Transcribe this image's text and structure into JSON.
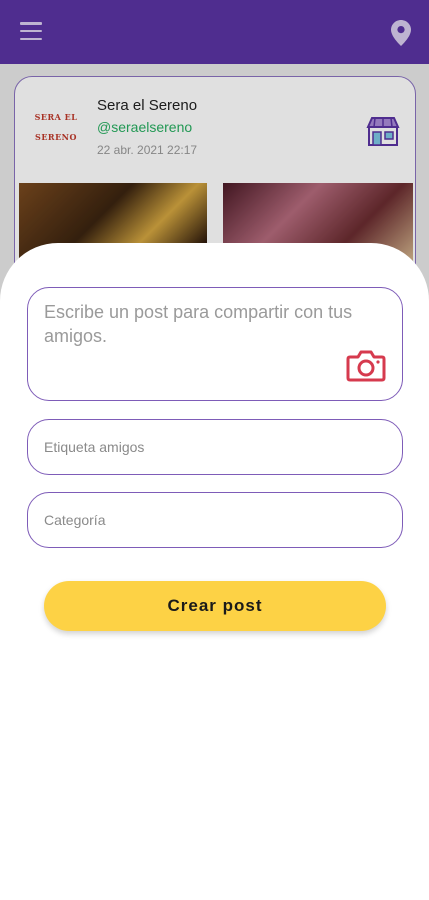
{
  "app_bar": {
    "menu_icon": "menu-icon",
    "location_icon": "location-pin-icon",
    "color": "#5b34a3"
  },
  "feed_post": {
    "logo_text": "SERA EL SERENO",
    "author": "Sera el Sereno",
    "handle": "@seraelsereno",
    "date": "22 abr. 2021 22:17",
    "store_icon": "store-icon"
  },
  "create_post_sheet": {
    "post_placeholder": "Escribe un post para compartir con tus amigos.",
    "camera_icon": "camera-icon",
    "tag_friends_placeholder": "Etiqueta amigos",
    "category_placeholder": "Categoría",
    "submit_label": "Crear post",
    "accent_color": "#7e5cb8",
    "button_color": "#fdd245",
    "camera_color": "#d63a4e"
  }
}
